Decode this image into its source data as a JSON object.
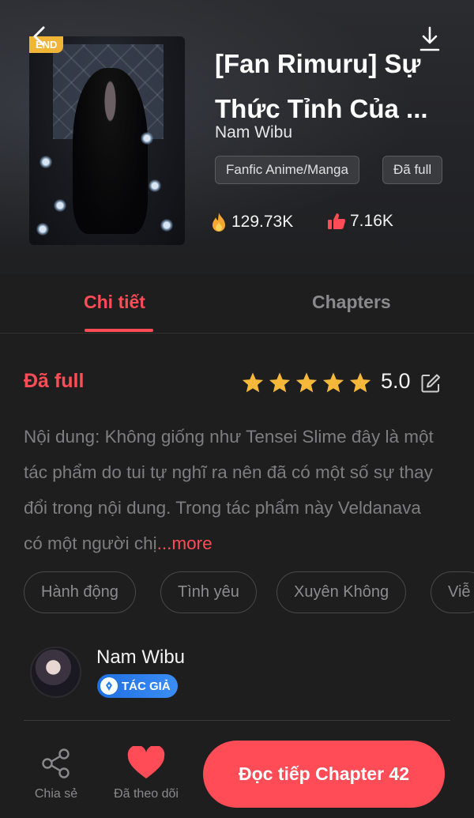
{
  "header": {
    "badge": "END",
    "title": "[Fan Rimuru] Sự Thức Tỉnh Của ...",
    "author": "Nam Wibu",
    "tags": [
      "Fanfic Anime/Manga",
      "Đã full"
    ],
    "stats": {
      "views": "129.73K",
      "likes": "7.16K"
    }
  },
  "tabs": [
    {
      "label": "Chi tiết",
      "active": true
    },
    {
      "label": "Chapters",
      "active": false
    }
  ],
  "detail": {
    "status": "Đã full",
    "rating": "5.0",
    "stars": 5,
    "description": "Nội dung: Không giống như Tensei Slime đây là một tác phẩm do tui tự nghĩ ra nên đã có một số sự thay đổi trong nội dung. Trong tác phẩm này Veldanava có một người chị",
    "more": "...more",
    "genres": [
      "Hành động",
      "Tình yêu",
      "Xuyên Không",
      "Viễ"
    ]
  },
  "author_section": {
    "name": "Nam Wibu",
    "badge": "TÁC GIẢ"
  },
  "bottom_bar": {
    "share": "Chia sẻ",
    "follow": "Đã theo dõi",
    "read_button": "Đọc tiếp Chapter 42"
  },
  "colors": {
    "accent": "#ff4c56",
    "star": "#f5b83a",
    "end_badge": "#f0b536",
    "author_badge": "#2f80ed"
  },
  "icons": {
    "back": "chevron-left-icon",
    "download": "download-icon",
    "views": "fire-icon",
    "likes": "thumbs-up-icon",
    "edit": "edit-icon",
    "share": "share-icon",
    "follow": "heart-icon"
  }
}
